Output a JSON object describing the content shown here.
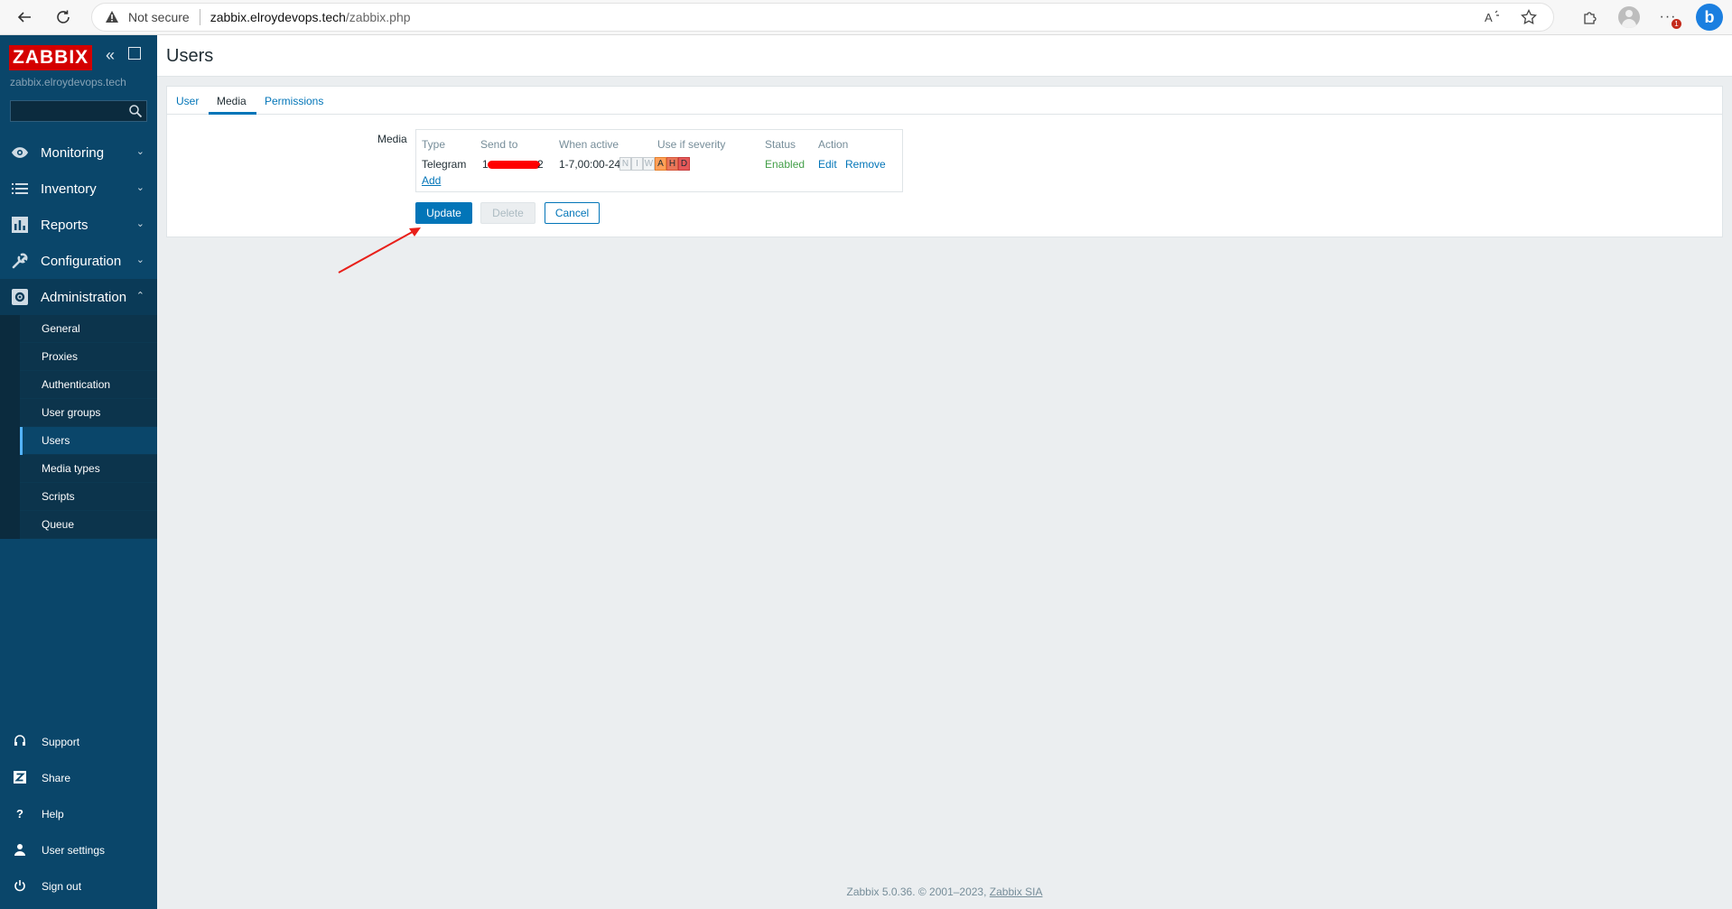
{
  "browser": {
    "security_label": "Not secure",
    "url_host": "zabbix.elroydevops.tech",
    "url_path": "/zabbix.php",
    "notification_count": "1"
  },
  "sidebar": {
    "logo": "ZABBIX",
    "server_name": "zabbix.elroydevops.tech",
    "search_placeholder": "",
    "menu": [
      {
        "label": "Monitoring",
        "icon": "eye-icon"
      },
      {
        "label": "Inventory",
        "icon": "list-icon"
      },
      {
        "label": "Reports",
        "icon": "bar-chart-icon"
      },
      {
        "label": "Configuration",
        "icon": "wrench-icon"
      },
      {
        "label": "Administration",
        "icon": "gear-icon"
      }
    ],
    "admin_submenu": [
      "General",
      "Proxies",
      "Authentication",
      "User groups",
      "Users",
      "Media types",
      "Scripts",
      "Queue"
    ],
    "bottom": [
      {
        "label": "Support",
        "icon": "headset-icon"
      },
      {
        "label": "Share",
        "icon": "share-z-icon"
      },
      {
        "label": "Help",
        "icon": "question-icon"
      },
      {
        "label": "User settings",
        "icon": "user-icon"
      },
      {
        "label": "Sign out",
        "icon": "power-icon"
      }
    ]
  },
  "page": {
    "title": "Users",
    "tabs": [
      "User",
      "Media",
      "Permissions"
    ],
    "active_tab": "Media"
  },
  "media": {
    "field_label": "Media",
    "headers": [
      "Type",
      "Send to",
      "When active",
      "Use if severity",
      "Status",
      "Action"
    ],
    "row": {
      "type": "Telegram",
      "send_to_first": "1",
      "send_to_last": "2",
      "when_active": "1-7,00:00-24:00",
      "severities": [
        "N",
        "I",
        "W",
        "A",
        "H",
        "D"
      ],
      "status": "Enabled",
      "edit": "Edit",
      "remove": "Remove"
    },
    "add_label": "Add"
  },
  "buttons": {
    "update": "Update",
    "delete": "Delete",
    "cancel": "Cancel"
  },
  "footer": {
    "text": "Zabbix 5.0.36. © 2001–2023,",
    "link": "Zabbix SIA"
  },
  "colors": {
    "sidebar_bg": "#0a466a",
    "accent": "#0275b8",
    "logo_red": "#d40000",
    "enabled_green": "#429e47"
  }
}
